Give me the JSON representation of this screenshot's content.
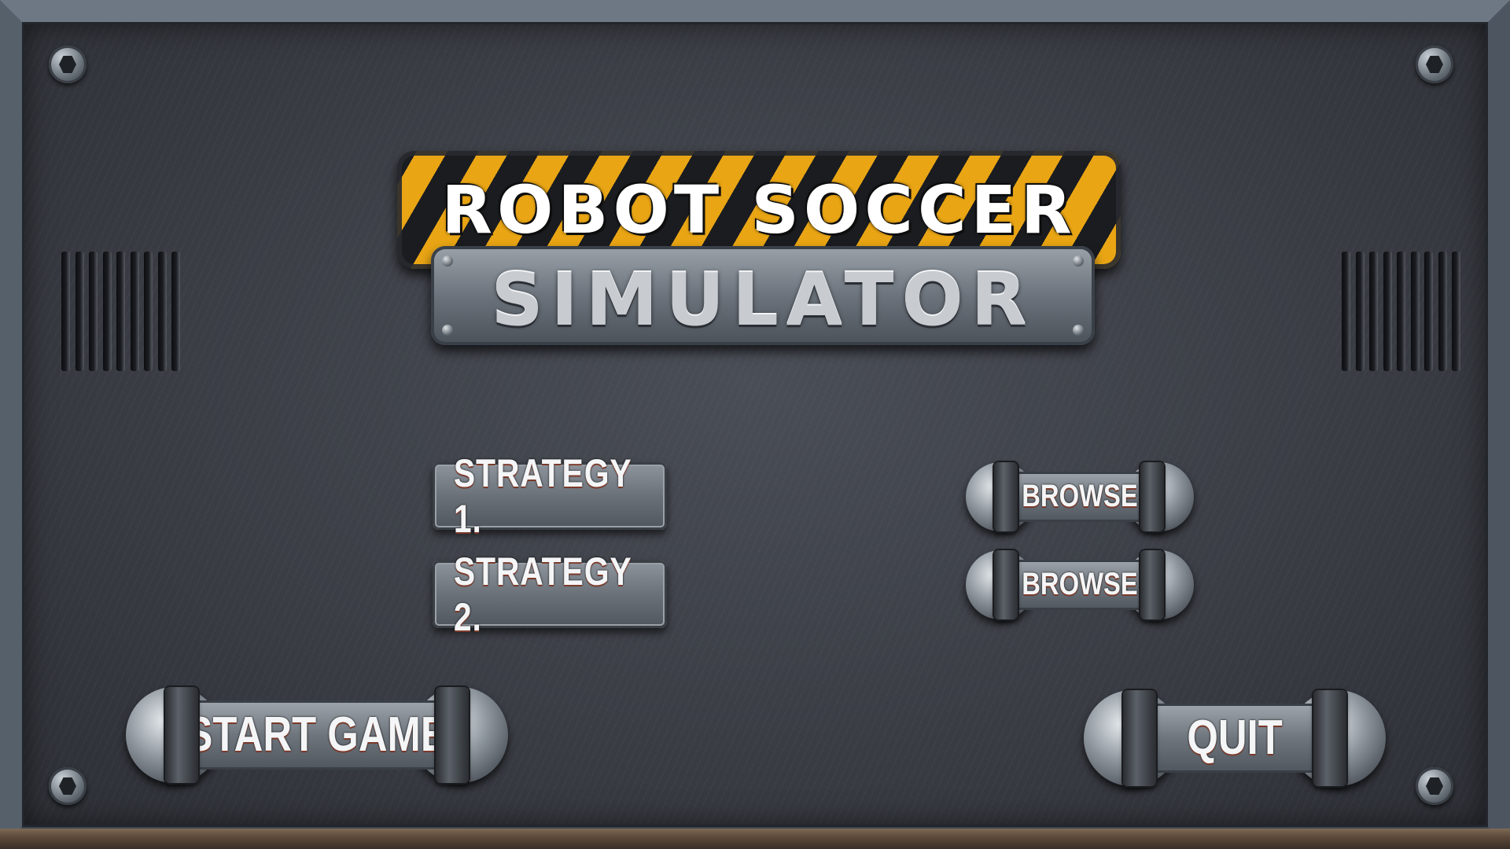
{
  "title": {
    "line1": "ROBOT SOCCER",
    "line2": "SIMULATOR"
  },
  "strategies": [
    {
      "label": "STRATEGY 1.",
      "browse_label": "BROWSE"
    },
    {
      "label": "STRATEGY 2.",
      "browse_label": "BROWSE"
    }
  ],
  "actions": {
    "start_label": "START GAME",
    "quit_label": "QUIT"
  },
  "colors": {
    "hazard_yellow": "#e9a514",
    "hazard_black": "#1a1c20",
    "metal": "#6e757d"
  }
}
